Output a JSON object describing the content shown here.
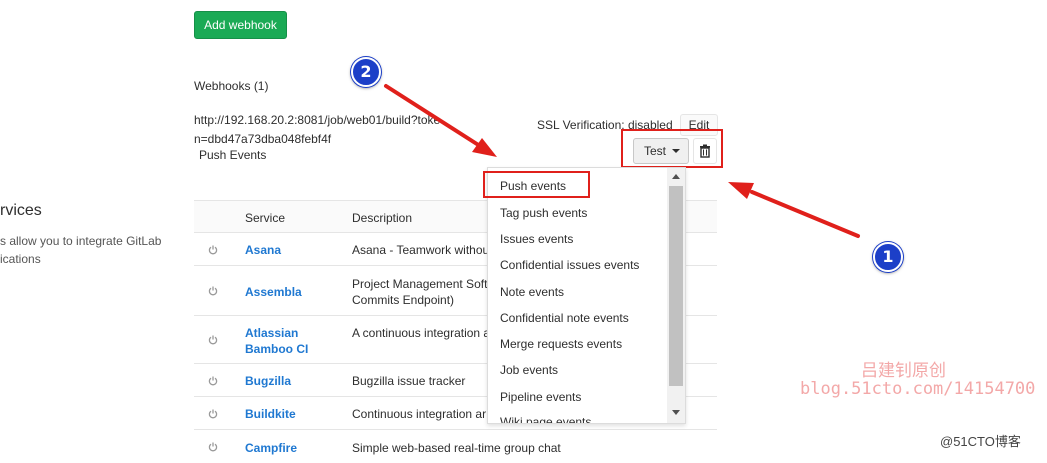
{
  "actions": {
    "add_webhook_label": "Add webhook"
  },
  "webhooks": {
    "heading": "Webhooks (1)",
    "url": "http://192.168.20.2:8081/job/web01/build?token=dbd47a73dba048febf4f",
    "events": "Push Events",
    "ssl_status": "SSL Verification: disabled",
    "edit_label": "Edit",
    "test_label": "Test"
  },
  "test_dropdown": {
    "items": [
      "Push events",
      "Tag push events",
      "Issues events",
      "Confidential issues events",
      "Note events",
      "Confidential note events",
      "Merge requests events",
      "Job events",
      "Pipeline events",
      "Wiki page events"
    ]
  },
  "services": {
    "title": "rvices",
    "description_line1": "s allow you to integrate GitLab",
    "description_line2": "ications",
    "columns": [
      "Service",
      "Description"
    ],
    "rows": [
      {
        "name": "Asana",
        "description": "Asana - Teamwork withou"
      },
      {
        "name": "Assembla",
        "description": "Project Management Soft\nCommits Endpoint)"
      },
      {
        "name": "Atlassian\nBamboo CI",
        "description": "A continuous integration a"
      },
      {
        "name": "Bugzilla",
        "description": "Bugzilla issue tracker"
      },
      {
        "name": "Buildkite",
        "description": "Continuous integration ar"
      },
      {
        "name": "Campfire",
        "description": "Simple web-based real-time group chat"
      }
    ]
  },
  "annotations": {
    "badge_1": "1",
    "badge_2": "2",
    "highlight_color": "#e0201b",
    "badge_color": "#1c3fc8"
  },
  "watermark": {
    "line1": "吕建钊原创",
    "line2": "blog.51cto.com/14154700",
    "corner": "@51CTO博客"
  }
}
